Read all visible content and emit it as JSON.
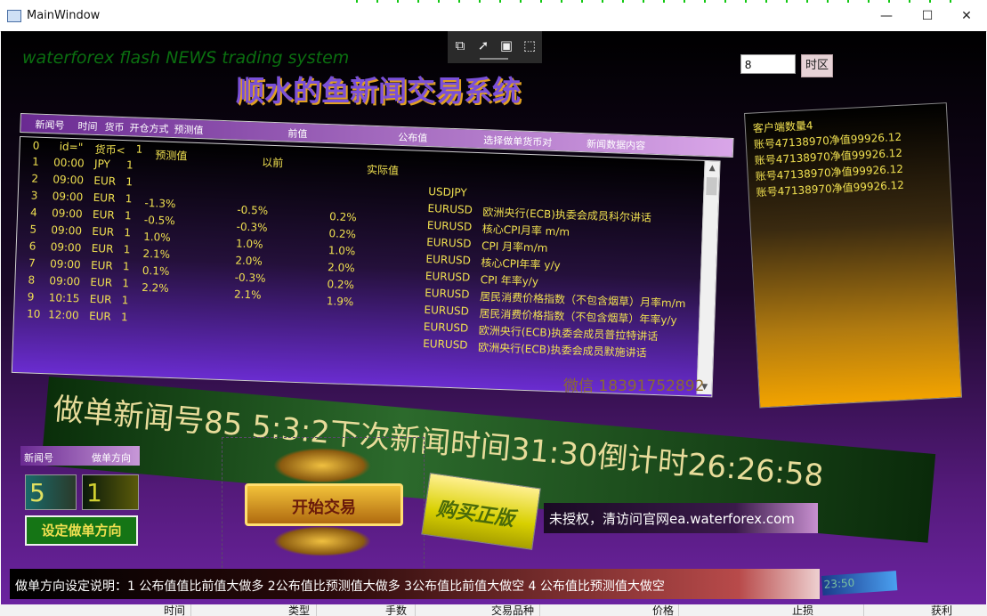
{
  "window": {
    "title": "MainWindow",
    "minimize": "—",
    "maximize": "☐",
    "close": "✕"
  },
  "toolbar": {
    "icons": [
      "select-element-icon",
      "pointer-icon",
      "frame-icon",
      "track-icon"
    ]
  },
  "brand": "waterforex flash NEWS trading system",
  "main_title": "顺水的鱼新闻交易系统",
  "timezone": {
    "value": "8",
    "button_label": "时区"
  },
  "grid": {
    "header": [
      "新闻号",
      "时间",
      "货币",
      "开仓方式",
      "预测值",
      "前值",
      "公布值",
      "选择做单货币对",
      "新闻数据内容"
    ],
    "first_row": {
      "c0": "0",
      "c1": "id=\"",
      "c2": "货币<",
      "c3": "1",
      "c4": "预测值",
      "c5": "以前",
      "c6": "实际值"
    },
    "rows": [
      {
        "id": "1",
        "time": "00:00",
        "currency": "JPY",
        "mode": "1",
        "forecast": "",
        "previous": "",
        "actual": "",
        "pair": "USDJPY",
        "content": ""
      },
      {
        "id": "2",
        "time": "09:00",
        "currency": "EUR",
        "mode": "1",
        "forecast": "",
        "previous": "",
        "actual": "",
        "pair": "EURUSD",
        "content": "欧洲央行(ECB)执委会成员科尔讲话"
      },
      {
        "id": "3",
        "time": "09:00",
        "currency": "EUR",
        "mode": "1",
        "forecast": "-1.3%",
        "previous": "-0.5%",
        "actual": "0.2%",
        "pair": "EURUSD",
        "content": "核心CPI月率 m/m"
      },
      {
        "id": "4",
        "time": "09:00",
        "currency": "EUR",
        "mode": "1",
        "forecast": "-0.5%",
        "previous": "-0.3%",
        "actual": "0.2%",
        "pair": "EURUSD",
        "content": "CPI 月率m/m"
      },
      {
        "id": "5",
        "time": "09:00",
        "currency": "EUR",
        "mode": "1",
        "forecast": "1.0%",
        "previous": "1.0%",
        "actual": "1.0%",
        "pair": "EURUSD",
        "content": "核心CPI年率 y/y"
      },
      {
        "id": "6",
        "time": "09:00",
        "currency": "EUR",
        "mode": "1",
        "forecast": "2.1%",
        "previous": "2.0%",
        "actual": "2.0%",
        "pair": "EURUSD",
        "content": "CPI 年率y/y"
      },
      {
        "id": "7",
        "time": "09:00",
        "currency": "EUR",
        "mode": "1",
        "forecast": "0.1%",
        "previous": "-0.3%",
        "actual": "0.2%",
        "pair": "EURUSD",
        "content": "居民消费价格指数（不包含烟草）月率m/m"
      },
      {
        "id": "8",
        "time": "09:00",
        "currency": "EUR",
        "mode": "1",
        "forecast": "2.2%",
        "previous": "2.1%",
        "actual": "1.9%",
        "pair": "EURUSD",
        "content": "居民消费价格指数（不包含烟草）年率y/y"
      },
      {
        "id": "9",
        "time": "10:15",
        "currency": "EUR",
        "mode": "1",
        "forecast": "",
        "previous": "",
        "actual": "",
        "pair": "EURUSD",
        "content": "欧洲央行(ECB)执委会成员普拉特讲话"
      },
      {
        "id": "10",
        "time": "12:00",
        "currency": "EUR",
        "mode": "1",
        "forecast": "",
        "previous": "",
        "actual": "",
        "pair": "EURUSD",
        "content": "欧洲央行(ECB)执委会成员默施讲话"
      }
    ]
  },
  "accounts": {
    "title": "客户端数量4",
    "lines": [
      "账号47138970净值99926.12",
      "账号47138970净值99926.12",
      "账号47138970净值99926.12",
      "账号47138970净值99926.12"
    ]
  },
  "banner": "做单新闻号85   5:3:2下次新闻时间31:30倒计时26:26:58",
  "wechat": "微信 18391752892",
  "direction": {
    "header_news": "新闻号",
    "header_dir": "做单方向",
    "news_value": "5",
    "dir_value": "1",
    "set_label": "设定做单方向"
  },
  "plaque": "开始交易",
  "buy": "购买正版",
  "license": "未授权，清访问官网ea.waterforex.com",
  "description": "做单方向设定说明：1 公布值值比前值大做多  2公布值比预测值大做多  3公布值比前值大做空 4 公布值比预测值大做空",
  "clock": "23:50",
  "bottom_columns": [
    "时间",
    "类型",
    "手数",
    "交易品种",
    "价格",
    "止损",
    "获利"
  ],
  "colors": {
    "accent_yellow": "#f0e050",
    "banner_text": "#e8dc9a",
    "title_purple": "#7a50d8"
  }
}
